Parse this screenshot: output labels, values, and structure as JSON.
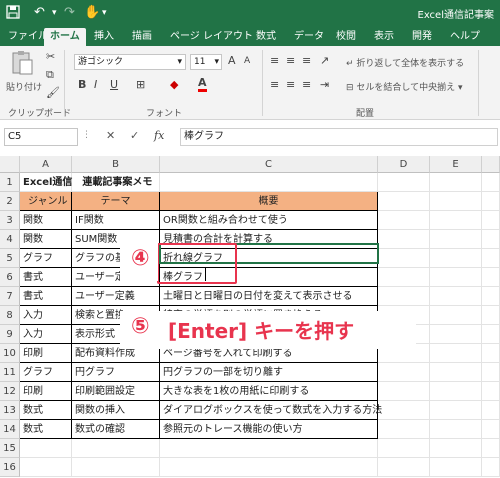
{
  "window": {
    "title": "Excel通信記事案",
    "undo_icon": "undo-icon",
    "redo_icon": "redo-icon"
  },
  "ribbon_tabs": [
    "ファイル",
    "ホーム",
    "挿入",
    "描画",
    "ページ レイアウト",
    "数式",
    "データ",
    "校閲",
    "表示",
    "開発",
    "ヘルプ"
  ],
  "ribbon": {
    "paste_label": "貼り付け",
    "clipboard_group": "クリップボード",
    "font_name": "游ゴシック",
    "font_size": "11",
    "font_group": "フォント",
    "wrap_text": "折り返して全体を表示する",
    "merge_center": "セルを結合して中央揃え",
    "alignment_group": "配置",
    "bold": "B",
    "italic": "I",
    "underline": "U",
    "grow_font": "A",
    "shrink_font": "A",
    "font_color_glyph": "A"
  },
  "formula_bar": {
    "name_box": "C5",
    "fx_label": "fx",
    "content": "棒グラフ"
  },
  "columns": [
    "A",
    "B",
    "C",
    "D",
    "E"
  ],
  "rows": [
    {
      "num": "1",
      "a": "Excel通信　連載記事案メモ",
      "b": "",
      "c": ""
    },
    {
      "num": "2",
      "a": "ジャンル",
      "b": "テーマ",
      "c": "概要"
    },
    {
      "num": "3",
      "a": "関数",
      "b": "IF関数",
      "c": "OR関数と組み合わせて使う"
    },
    {
      "num": "4",
      "a": "関数",
      "b": "SUM関数",
      "c": "見積書の合計を計算する"
    },
    {
      "num": "5",
      "a": "グラフ",
      "b": "グラフの基",
      "c": "折れ線グラフ"
    },
    {
      "num": "6",
      "a": "書式",
      "b": "ユーザー定",
      "c": "棒グラフ"
    },
    {
      "num": "7",
      "a": "書式",
      "b": "ユーザー定義",
      "c": "土曜日と日曜日の日付を変えて表示させる"
    },
    {
      "num": "8",
      "a": "入力",
      "b": "検索と置換",
      "c": "特定の単語を別の単語に置き換える"
    },
    {
      "num": "9",
      "a": "入力",
      "b": "表示形式",
      "c": ""
    },
    {
      "num": "10",
      "a": "印刷",
      "b": "配布資料作成",
      "c": "ページ番号を入れて印刷する"
    },
    {
      "num": "11",
      "a": "グラフ",
      "b": "円グラフ",
      "c": "円グラフの一部を切り離す"
    },
    {
      "num": "12",
      "a": "印刷",
      "b": "印刷範囲設定",
      "c": "大きな表を1枚の用紙に印刷する"
    },
    {
      "num": "13",
      "a": "数式",
      "b": "関数の挿入",
      "c": "ダイアログボックスを使って数式を入力する方法"
    },
    {
      "num": "14",
      "a": "数式",
      "b": "数式の確認",
      "c": "参照元のトレース機能の使い方"
    },
    {
      "num": "15",
      "a": "",
      "b": "",
      "c": ""
    },
    {
      "num": "16",
      "a": "",
      "b": "",
      "c": ""
    }
  ],
  "annotations": {
    "step4": "④",
    "step5_num": "⑤",
    "step5_text": "[Enter] キーを押す"
  },
  "colors": {
    "excel_green": "#217346",
    "header_fill": "#f4b183",
    "annotation_red": "#e8344e"
  }
}
